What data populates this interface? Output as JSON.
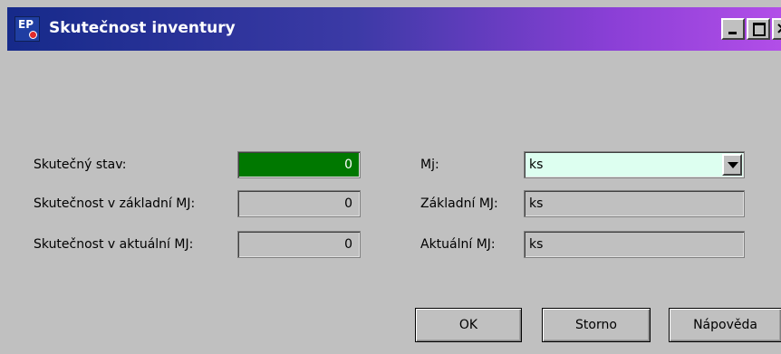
{
  "window": {
    "title": "Skutečnost inventury",
    "icon_text": "EP"
  },
  "left": {
    "actual_state_label": "Skutečný stav:",
    "actual_state_value": "0",
    "base_label": "Skutečnost v základní MJ:",
    "base_value": "0",
    "current_label": "Skutečnost v aktuální MJ:",
    "current_value": "0"
  },
  "right": {
    "mj_label": "Mj:",
    "mj_value": "ks",
    "base_mj_label": "Základní MJ:",
    "base_mj_value": "ks",
    "current_mj_label": "Aktuální MJ:",
    "current_mj_value": "ks"
  },
  "buttons": {
    "ok": "OK",
    "storno": "Storno",
    "help": "Nápověda"
  },
  "colors": {
    "actual_state_field": "#007800",
    "mj_combo": "#ddfff0"
  }
}
